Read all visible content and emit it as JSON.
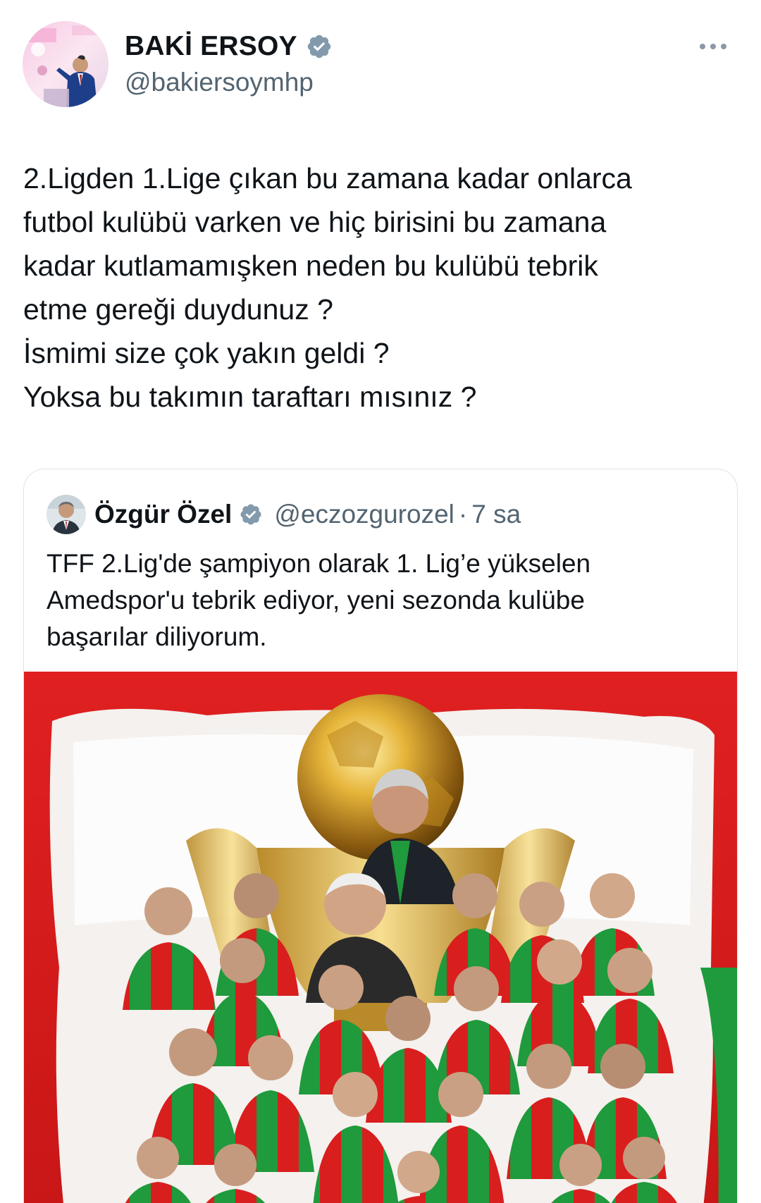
{
  "tweet": {
    "author": {
      "display_name": "BAKİ ERSOY",
      "handle": "@bakiersoymhp",
      "verified": true
    },
    "text_lines": [
      "2.Ligden 1.Lige çıkan bu zamana kadar onlarca",
      "futbol kulübü varken ve hiç birisini bu zamana",
      "kadar kutlamamışken neden bu kulübü tebrik",
      "etme gereği duydunuz ?",
      "İsmimi size çok yakın geldi ?",
      "Yoksa bu takımın taraftarı mısınız ?"
    ]
  },
  "quoted_tweet": {
    "author": {
      "display_name": "Özgür Özel",
      "handle": "@eczozgurozel",
      "verified": true
    },
    "separator": "·",
    "time": "7 sa",
    "text_lines": [
      "TFF 2.Lig'de şampiyon olarak 1. Lig’e yükselen",
      "Amedspor'u tebrik ediyor, yeni sezonda kulübe",
      "başarılar diliyorum."
    ]
  },
  "icons": {
    "verified": "verified-badge-icon",
    "more": "more-options-icon"
  },
  "colors": {
    "text_primary": "#0f1419",
    "text_secondary": "#536471",
    "verified_badge": "#829aab",
    "card_border": "#dfe3e6",
    "team_red": "#d81e1e",
    "team_green": "#1f9a3c",
    "trophy_gold": "#d9a628"
  }
}
